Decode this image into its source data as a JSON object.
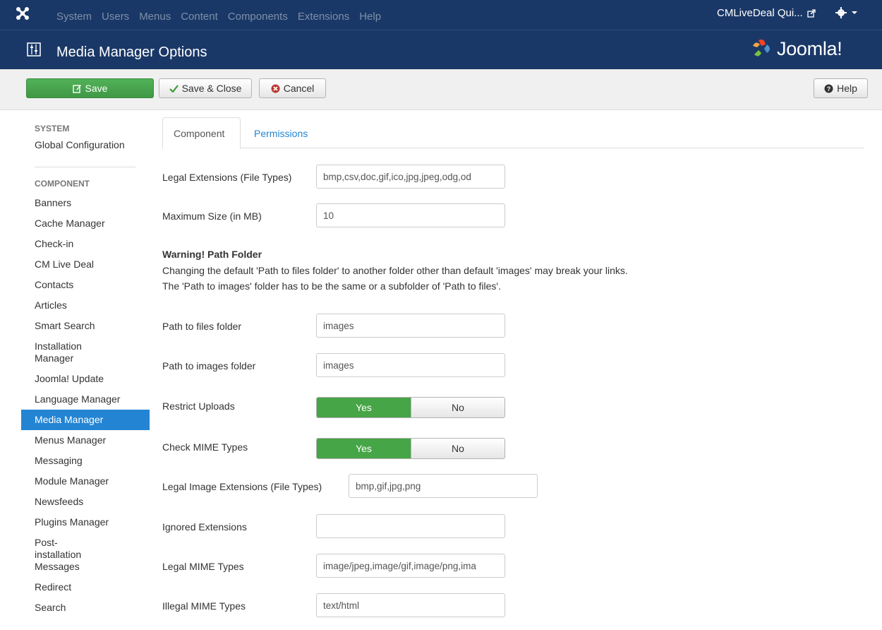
{
  "navbar": {
    "menu": [
      "System",
      "Users",
      "Menus",
      "Content",
      "Components",
      "Extensions",
      "Help"
    ],
    "site_name": "CMLiveDeal Qui...",
    "logo_icon": "joomla-logo-icon",
    "gear_icon": "gear-icon"
  },
  "header": {
    "title": "Media Manager Options",
    "brand": "Joomla!"
  },
  "toolbar": {
    "save_label": "Save",
    "save_close_label": "Save & Close",
    "cancel_label": "Cancel",
    "help_label": "Help"
  },
  "sidebar": {
    "system_heading": "SYSTEM",
    "global_config": "Global Configuration",
    "component_heading": "COMPONENT",
    "items": [
      "Banners",
      "Cache Manager",
      "Check-in",
      "CM Live Deal",
      "Contacts",
      "Articles",
      "Smart Search",
      "Installation Manager",
      "Joomla! Update",
      "Language Manager",
      "Media Manager",
      "Menus Manager",
      "Messaging",
      "Module Manager",
      "Newsfeeds",
      "Plugins Manager",
      "Post-installation Messages",
      "Redirect",
      "Search"
    ],
    "active_item": "Media Manager"
  },
  "tabs": {
    "component": "Component",
    "permissions": "Permissions"
  },
  "form": {
    "legal_extensions": {
      "label": "Legal Extensions (File Types)",
      "value": "bmp,csv,doc,gif,ico,jpg,jpeg,odg,od"
    },
    "max_size": {
      "label": "Maximum Size (in MB)",
      "value": "10"
    },
    "warning_title": "Warning! Path Folder",
    "warning_line1": "Changing the default 'Path to files folder' to another folder other than default 'images' may break your links.",
    "warning_line2": "The 'Path to images' folder has to be the same or a subfolder of 'Path to files'.",
    "files_path": {
      "label": "Path to files folder",
      "value": "images"
    },
    "images_path": {
      "label": "Path to images folder",
      "value": "images"
    },
    "restrict_uploads": {
      "label": "Restrict Uploads",
      "yes": "Yes",
      "no": "No",
      "selected": "Yes"
    },
    "check_mime": {
      "label": "Check MIME Types",
      "yes": "Yes",
      "no": "No",
      "selected": "Yes"
    },
    "legal_image_ext": {
      "label": "Legal Image Extensions (File Types)",
      "value": "bmp,gif,jpg,png"
    },
    "ignored_ext": {
      "label": "Ignored Extensions",
      "value": ""
    },
    "legal_mime": {
      "label": "Legal MIME Types",
      "value": "image/jpeg,image/gif,image/png,ima"
    },
    "illegal_mime": {
      "label": "Illegal MIME Types",
      "value": "text/html"
    }
  },
  "colors": {
    "navbar": "#1a3867",
    "save_green": "#46a546",
    "active_blue": "#2384d3",
    "toolbar_bg": "#f0f0f0"
  }
}
